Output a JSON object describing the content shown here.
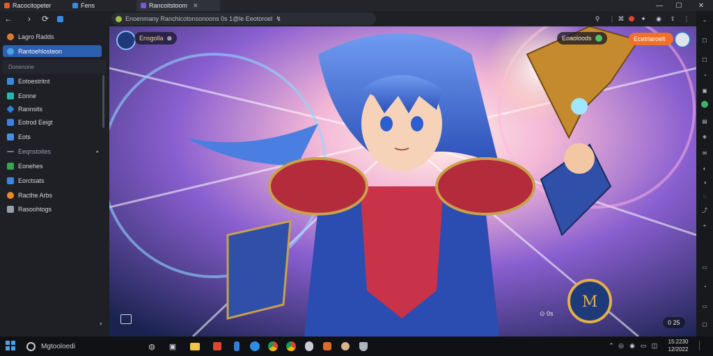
{
  "tabs": [
    {
      "label": "Racocitopeter",
      "active": false
    },
    {
      "label": "Fens",
      "active": false
    },
    {
      "label": "Rancoitstoom",
      "active": true,
      "close": "✕"
    }
  ],
  "window": {
    "minimize": "—",
    "maximize": "☐",
    "close": "✕"
  },
  "nav": {
    "back": "←",
    "forward": "›",
    "refresh": "⟳"
  },
  "address": {
    "text": "Enoenmany Ranchicotonsonoons 0s 1@le Eeotoroel",
    "trailing": "↯"
  },
  "sidebar": {
    "items_top": [
      {
        "label": "Lagro Radds",
        "icon": "orange-circle-icon",
        "color": "#e07a2a",
        "selected": false
      },
      {
        "label": "Rantoehlosteon",
        "icon": "globe-icon",
        "color": "#4aa3e8",
        "selected": true
      }
    ],
    "section": "Donenone",
    "items": [
      {
        "label": "Eotoestritnt",
        "icon": "blue-file-icon",
        "color": "#3a8be0"
      },
      {
        "label": "Eonne",
        "icon": "teal-icon",
        "color": "#2ab7a9"
      },
      {
        "label": "Rannsits",
        "icon": "blue-gem-icon",
        "color": "#2f7fd6"
      },
      {
        "label": "Eotrod Eeigt",
        "icon": "blue-doc-icon",
        "color": "#3c7ee6"
      },
      {
        "label": "Eots",
        "icon": "blue-folder-icon",
        "color": "#4a90e2"
      },
      {
        "label": "Eeqnstoites",
        "icon": "dash-icon",
        "color": "#777d86"
      },
      {
        "label": "Eonehes",
        "icon": "green-icon",
        "color": "#37a455"
      },
      {
        "label": "Eorctsats",
        "icon": "blue-icon",
        "color": "#3a86e0"
      },
      {
        "label": "Racthe Arbs",
        "icon": "orange-gear-icon",
        "color": "#e88a2a"
      },
      {
        "label": "Rasoohtogs",
        "icon": "gray-icon",
        "color": "#9aa0a8"
      }
    ]
  },
  "overlay": {
    "player_name": "Ensgolla",
    "player_badge": "⊗",
    "chip_label": "Eoaoloods",
    "action_label": "Ecetrlaroelt",
    "bottom_info": "⊙ 0s",
    "time_badge": "0 25"
  },
  "taskbar": {
    "search_placeholder": "Mgtooloedi",
    "clock_time": "15:2230",
    "clock_date": "12/2022"
  }
}
